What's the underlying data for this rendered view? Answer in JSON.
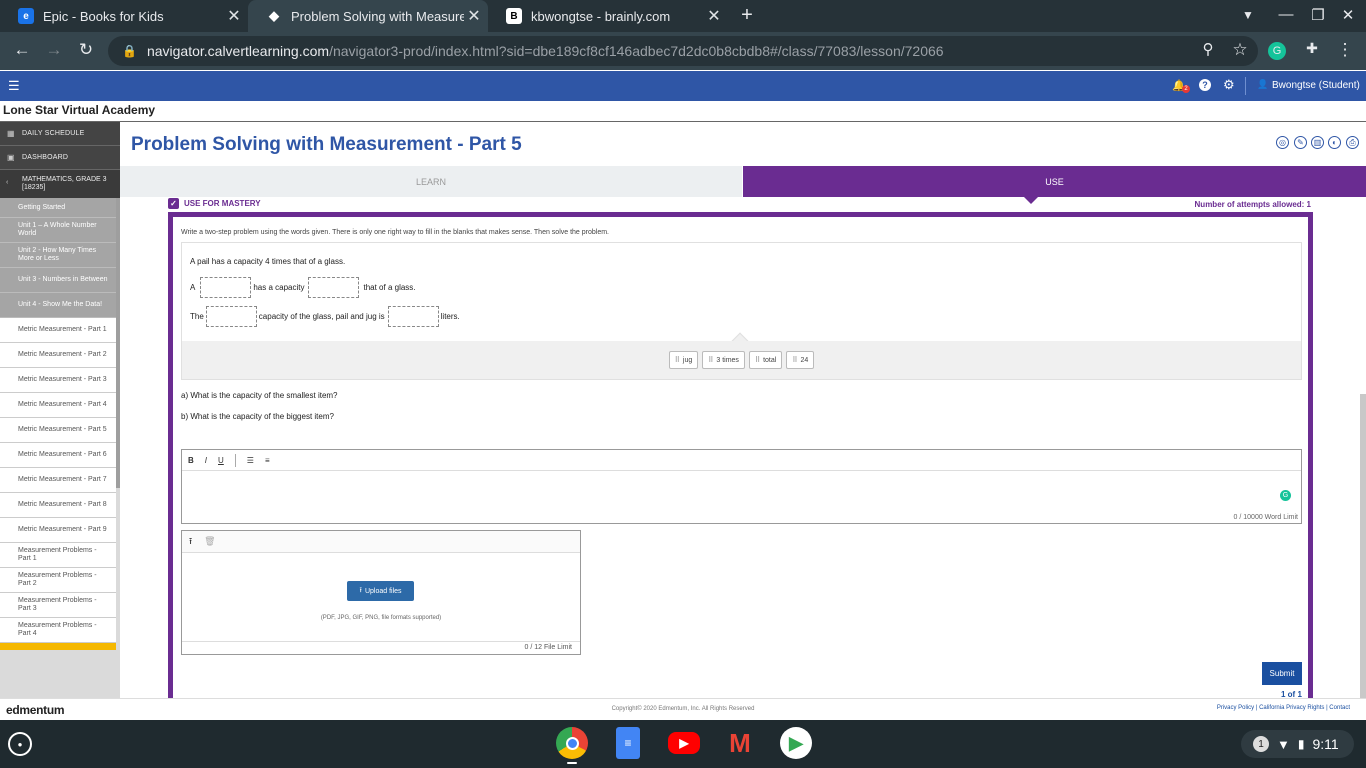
{
  "browser": {
    "tabs": [
      {
        "title": "Epic - Books for Kids",
        "icon": "epic-favicon"
      },
      {
        "title": "Problem Solving with Measurem",
        "icon": "calvert-favicon"
      },
      {
        "title": "kbwongtse - brainly.com",
        "icon": "brainly-favicon"
      }
    ],
    "url_host": "navigator.calvertlearning.com",
    "url_path": "/navigator3-prod/index.html?sid=dbe189cf8cf146adbec7d2dc0b8cbdb8#/class/77083/lesson/72066"
  },
  "header": {
    "notif_count": "2",
    "user": "Bwongtse (Student)"
  },
  "org": "Lone Star Virtual Academy",
  "sidebar": {
    "daily": "DAILY SCHEDULE",
    "dashboard": "DASHBOARD",
    "course": "MATHEMATICS, GRADE 3 [18235]",
    "units": [
      "Getting Started",
      "Unit 1 – A Whole Number World",
      "Unit 2 - How Many Times More or Less",
      "Unit 3 - Numbers in Between",
      "Unit 4 - Show Me the Data!"
    ],
    "lessons": [
      "Metric Measurement - Part 1",
      "Metric Measurement - Part 2",
      "Metric Measurement - Part 3",
      "Metric Measurement - Part 4",
      "Metric Measurement - Part 5",
      "Metric Measurement - Part 6",
      "Metric Measurement - Part 7",
      "Metric Measurement - Part 8",
      "Metric Measurement - Part 9",
      "Measurement Problems - Part 1",
      "Measurement Problems - Part 2",
      "Measurement Problems - Part 3",
      "Measurement Problems - Part 4"
    ]
  },
  "page": {
    "title": "Problem Solving with Measurement - Part 5",
    "tab_learn": "LEARN",
    "tab_use": "USE",
    "mastery": "USE FOR MASTERY",
    "attempts": "Number of attempts allowed: 1"
  },
  "question": {
    "prompt": "Write a two-step problem using the words given. There is only one right way to fill in the blanks that makes sense. Then solve the problem.",
    "line1": "A pail has a capacity 4 times that of a glass.",
    "line2_a": "A",
    "line2_b": "has a capacity",
    "line2_c": "that of a glass.",
    "line3_a": "The",
    "line3_b": "capacity of the glass, pail and jug is",
    "line3_c": "liters.",
    "chips": [
      "jug",
      "3 times",
      "total",
      "24"
    ],
    "qa": "a) What is the capacity of the smallest item?",
    "qb": "b) What is the capacity of the biggest item?"
  },
  "editor": {
    "word_limit": "0 / 10000 Word Limit"
  },
  "upload": {
    "button": "Upload files",
    "hint": "(PDF, JPG, GIF, PNG, file formats supported)",
    "file_limit": "0 / 12 File Limit"
  },
  "submit": "Submit",
  "page_count": "1 of 1",
  "footer": {
    "logo": "edmentum",
    "copyright": "Copyright© 2020 Edmentum, Inc. All Rights Reserved",
    "links": "Privacy Policy | California Privacy Rights | Contact"
  },
  "shelf": {
    "time": "9:11",
    "notif": "1"
  }
}
